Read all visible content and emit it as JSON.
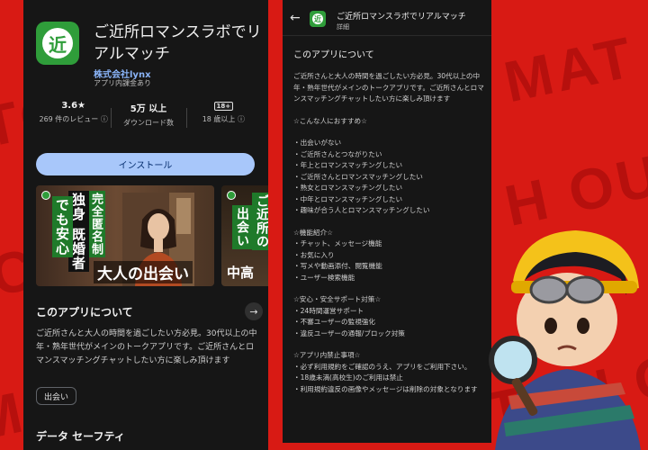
{
  "colors": {
    "background": "#d81a14",
    "panel": "#161616",
    "brand_green": "#2f9d3a",
    "install_button": "#a8c7fa",
    "link": "#8ab4f8"
  },
  "app": {
    "icon_glyph": "近",
    "title": "ご近所ロマンスラボでリアルマッチ",
    "developer": "株式会社lynx",
    "iap_note": "アプリ内課金あり"
  },
  "stats": {
    "rating_value": "3.6★",
    "rating_label": "269 件のレビュー ⓘ",
    "downloads_value": "5万 以上",
    "downloads_label": "ダウンロード数",
    "age_badge": "18+",
    "age_label": "18 歳以上 ⓘ"
  },
  "install_label": "インストール",
  "screenshot1": {
    "col1": "完全匿名制",
    "col2": "独身 既婚者",
    "col3": "でも安心",
    "caption": "大人の出会い"
  },
  "screenshot2": {
    "col1": "ご近所の",
    "col2": "出会い",
    "caption": "中高"
  },
  "about": {
    "title": "このアプリについて",
    "arrow": "→",
    "body": "ご近所さんと大人の時間を過ごしたい方必見。30代以上の中年・熟年世代がメインのトークアプリです。ご近所さんとロマンスマッチングチャットしたい方に楽しみ頂けます",
    "chip": "出会い"
  },
  "safety_title": "データ セーフティ",
  "detail": {
    "back": "←",
    "title": "ご近所ロマンスラボでリアルマッチ",
    "subtitle": "詳細",
    "section_title": "このアプリについて",
    "intro": "ご近所さんと大人の時間を過ごしたい方必見。30代以上の中年・熟年世代がメインのトークアプリです。ご近所さんとロマンスマッチングチャットしたい方に楽しみ頂けます",
    "recommend_title": "☆こんな人におすすめ☆",
    "recommend": [
      "・出会いがない",
      "・ご近所さんとつながりたい",
      "・年上とロマンスマッチングしたい",
      "・ご近所さんとロマンスマッチングしたい",
      "・熟女とロマンスマッチングしたい",
      "・中年とロマンスマッチングしたい",
      "・趣味が合う人とロマンスマッチングしたい"
    ],
    "features_title": "☆機能紹介☆",
    "features": [
      "・チャット、メッセージ機能",
      "・お気に入り",
      "・写メや動画添付、閲覧機能",
      "・ユーザー検索機能"
    ],
    "safety_title": "☆安心・安全サポート対策☆",
    "safety": [
      "・24時間運営サポート",
      "・不審ユーザーの監視強化",
      "・違反ユーザーの通報/ブロック対策"
    ],
    "prohibited_title": "☆アプリ内禁止事項☆",
    "prohibited": [
      "・必ず利用規約をご確認のうえ、アプリをご利用下さい。",
      "・18歳未満(高校生)のご利用は禁止",
      "・利用規約違反の画像やメッセージは削除の対象となります"
    ]
  },
  "watermarks": [
    "MAT",
    "TOU",
    "H OUT",
    "CH",
    "TCH OUT",
    "MA"
  ]
}
